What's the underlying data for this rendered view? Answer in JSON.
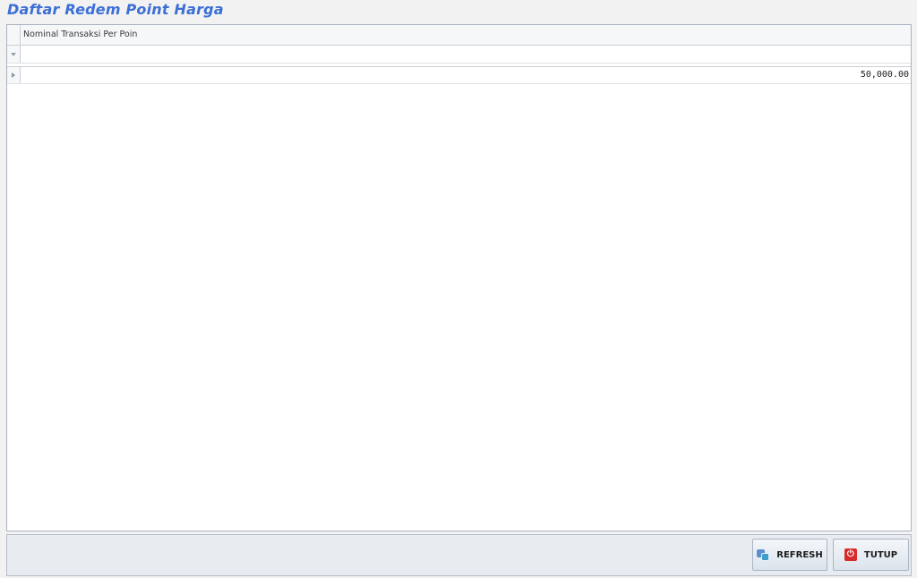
{
  "page": {
    "title": "Daftar Redem Point Harga"
  },
  "grid": {
    "columns": [
      {
        "header": "Nominal Transaksi Per Poin"
      }
    ],
    "rows": [
      {
        "nominal": "50,000.00"
      }
    ]
  },
  "footer": {
    "refresh_label": "REFRESH",
    "close_label": "TUTUP"
  },
  "icons": {
    "filter": "filter-icon",
    "row_indicator": "row-indicator-icon",
    "refresh": "refresh-icon",
    "close": "power-icon"
  },
  "colors": {
    "title": "#3c6fd6",
    "close_icon": "#d92a2a"
  }
}
